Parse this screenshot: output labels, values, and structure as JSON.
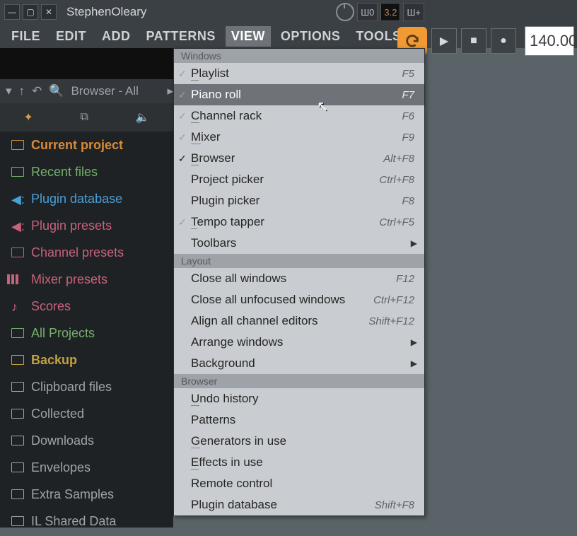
{
  "title": "StephenOleary",
  "menubar": [
    "FILE",
    "EDIT",
    "ADD",
    "PATTERNS",
    "VIEW",
    "OPTIONS",
    "TOOLS",
    "?"
  ],
  "active_menu_index": 4,
  "top_small": [
    "⟲",
    "Ш0",
    "3.2",
    "Ш+"
  ],
  "tempo": "140.00",
  "browser_header": "Browser - All",
  "browser_items": [
    {
      "label": "Current project",
      "color": "#d88a3a",
      "icon": "folder"
    },
    {
      "label": "Recent files",
      "color": "#74b06a",
      "icon": "folder"
    },
    {
      "label": "Plugin database",
      "color": "#4a9fd6",
      "icon": "speaker"
    },
    {
      "label": "Plugin presets",
      "color": "#c7627a",
      "icon": "speaker"
    },
    {
      "label": "Channel presets",
      "color": "#c7627a",
      "icon": "folder"
    },
    {
      "label": "Mixer presets",
      "color": "#c7627a",
      "icon": "sliders"
    },
    {
      "label": "Scores",
      "color": "#c7627a",
      "icon": "note"
    },
    {
      "label": "All Projects",
      "color": "#74b06a",
      "icon": "folder"
    },
    {
      "label": "Backup",
      "color": "#c1a23f",
      "icon": "folder"
    },
    {
      "label": "Clipboard files",
      "color": "#9fa4a8",
      "icon": "folder"
    },
    {
      "label": "Collected",
      "color": "#9fa4a8",
      "icon": "folder"
    },
    {
      "label": "Downloads",
      "color": "#9fa4a8",
      "icon": "folder"
    },
    {
      "label": "Envelopes",
      "color": "#9fa4a8",
      "icon": "folder"
    },
    {
      "label": "Extra Samples",
      "color": "#9fa4a8",
      "icon": "folder"
    },
    {
      "label": "IL Shared Data",
      "color": "#9fa4a8",
      "icon": "folder"
    }
  ],
  "menu": {
    "sections": [
      {
        "title": "Windows",
        "rows": [
          {
            "label": "Playlist",
            "u": "P",
            "shortcut": "F5",
            "check": "dim"
          },
          {
            "label": "Piano roll",
            "u": "",
            "shortcut": "F7",
            "check": "dim",
            "highlight": true
          },
          {
            "label": "Channel rack",
            "u": "C",
            "shortcut": "F6",
            "check": "dim"
          },
          {
            "label": "Mixer",
            "u": "M",
            "shortcut": "F9",
            "check": "dim"
          },
          {
            "label": "Browser",
            "u": "B",
            "shortcut": "Alt+F8",
            "check": "on"
          },
          {
            "label": "Project picker",
            "u": "",
            "shortcut": "Ctrl+F8"
          },
          {
            "label": "Plugin picker",
            "u": "",
            "shortcut": "F8"
          },
          {
            "label": "Tempo tapper",
            "u": "T",
            "shortcut": "Ctrl+F5",
            "check": "dim"
          },
          {
            "label": "Toolbars",
            "u": "",
            "caret": true
          }
        ]
      },
      {
        "title": "Layout",
        "rows": [
          {
            "label": "Close all windows",
            "u": "",
            "shortcut": "F12"
          },
          {
            "label": "Close all unfocused windows",
            "u": "",
            "shortcut": "Ctrl+F12"
          },
          {
            "label": "Align all channel editors",
            "u": "",
            "shortcut": "Shift+F12"
          },
          {
            "label": "Arrange windows",
            "u": "",
            "caret": true
          },
          {
            "label": "Background",
            "u": "",
            "caret": true
          }
        ]
      },
      {
        "title": "Browser",
        "rows": [
          {
            "label": "Undo history",
            "u": "U"
          },
          {
            "label": "Patterns",
            "u": ""
          },
          {
            "label": "Generators in use",
            "u": "G"
          },
          {
            "label": "Effects in use",
            "u": "E"
          },
          {
            "label": "Remote control",
            "u": ""
          },
          {
            "label": "Plugin database",
            "u": "",
            "shortcut": "Shift+F8"
          }
        ]
      }
    ]
  }
}
